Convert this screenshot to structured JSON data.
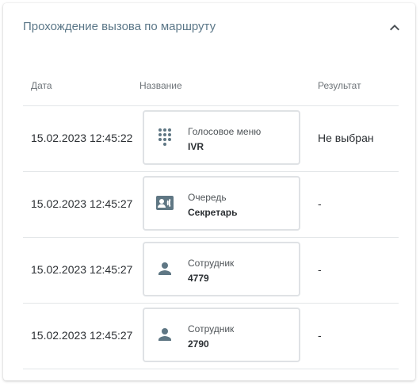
{
  "panel": {
    "title": "Прохождение вызова по маршруту",
    "collapse_icon": "chevron-up-icon"
  },
  "colors": {
    "title": "#5b7788",
    "icon": "#5f7784",
    "border": "#dfe2e5"
  },
  "table": {
    "headers": {
      "date": "Дата",
      "name": "Название",
      "result": "Результат"
    },
    "rows": [
      {
        "date": "15.02.2023 12:45:22",
        "icon": "dialpad-icon",
        "type": "Голосовое меню",
        "name": "IVR",
        "result": "Не выбран"
      },
      {
        "date": "15.02.2023 12:45:27",
        "icon": "contact-card-icon",
        "type": "Очередь",
        "name": "Секретарь",
        "result": "-"
      },
      {
        "date": "15.02.2023 12:45:27",
        "icon": "person-icon",
        "type": "Сотрудник",
        "name": "4779",
        "result": "-"
      },
      {
        "date": "15.02.2023 12:45:27",
        "icon": "person-icon",
        "type": "Сотрудник",
        "name": "2790",
        "result": "-"
      }
    ]
  }
}
